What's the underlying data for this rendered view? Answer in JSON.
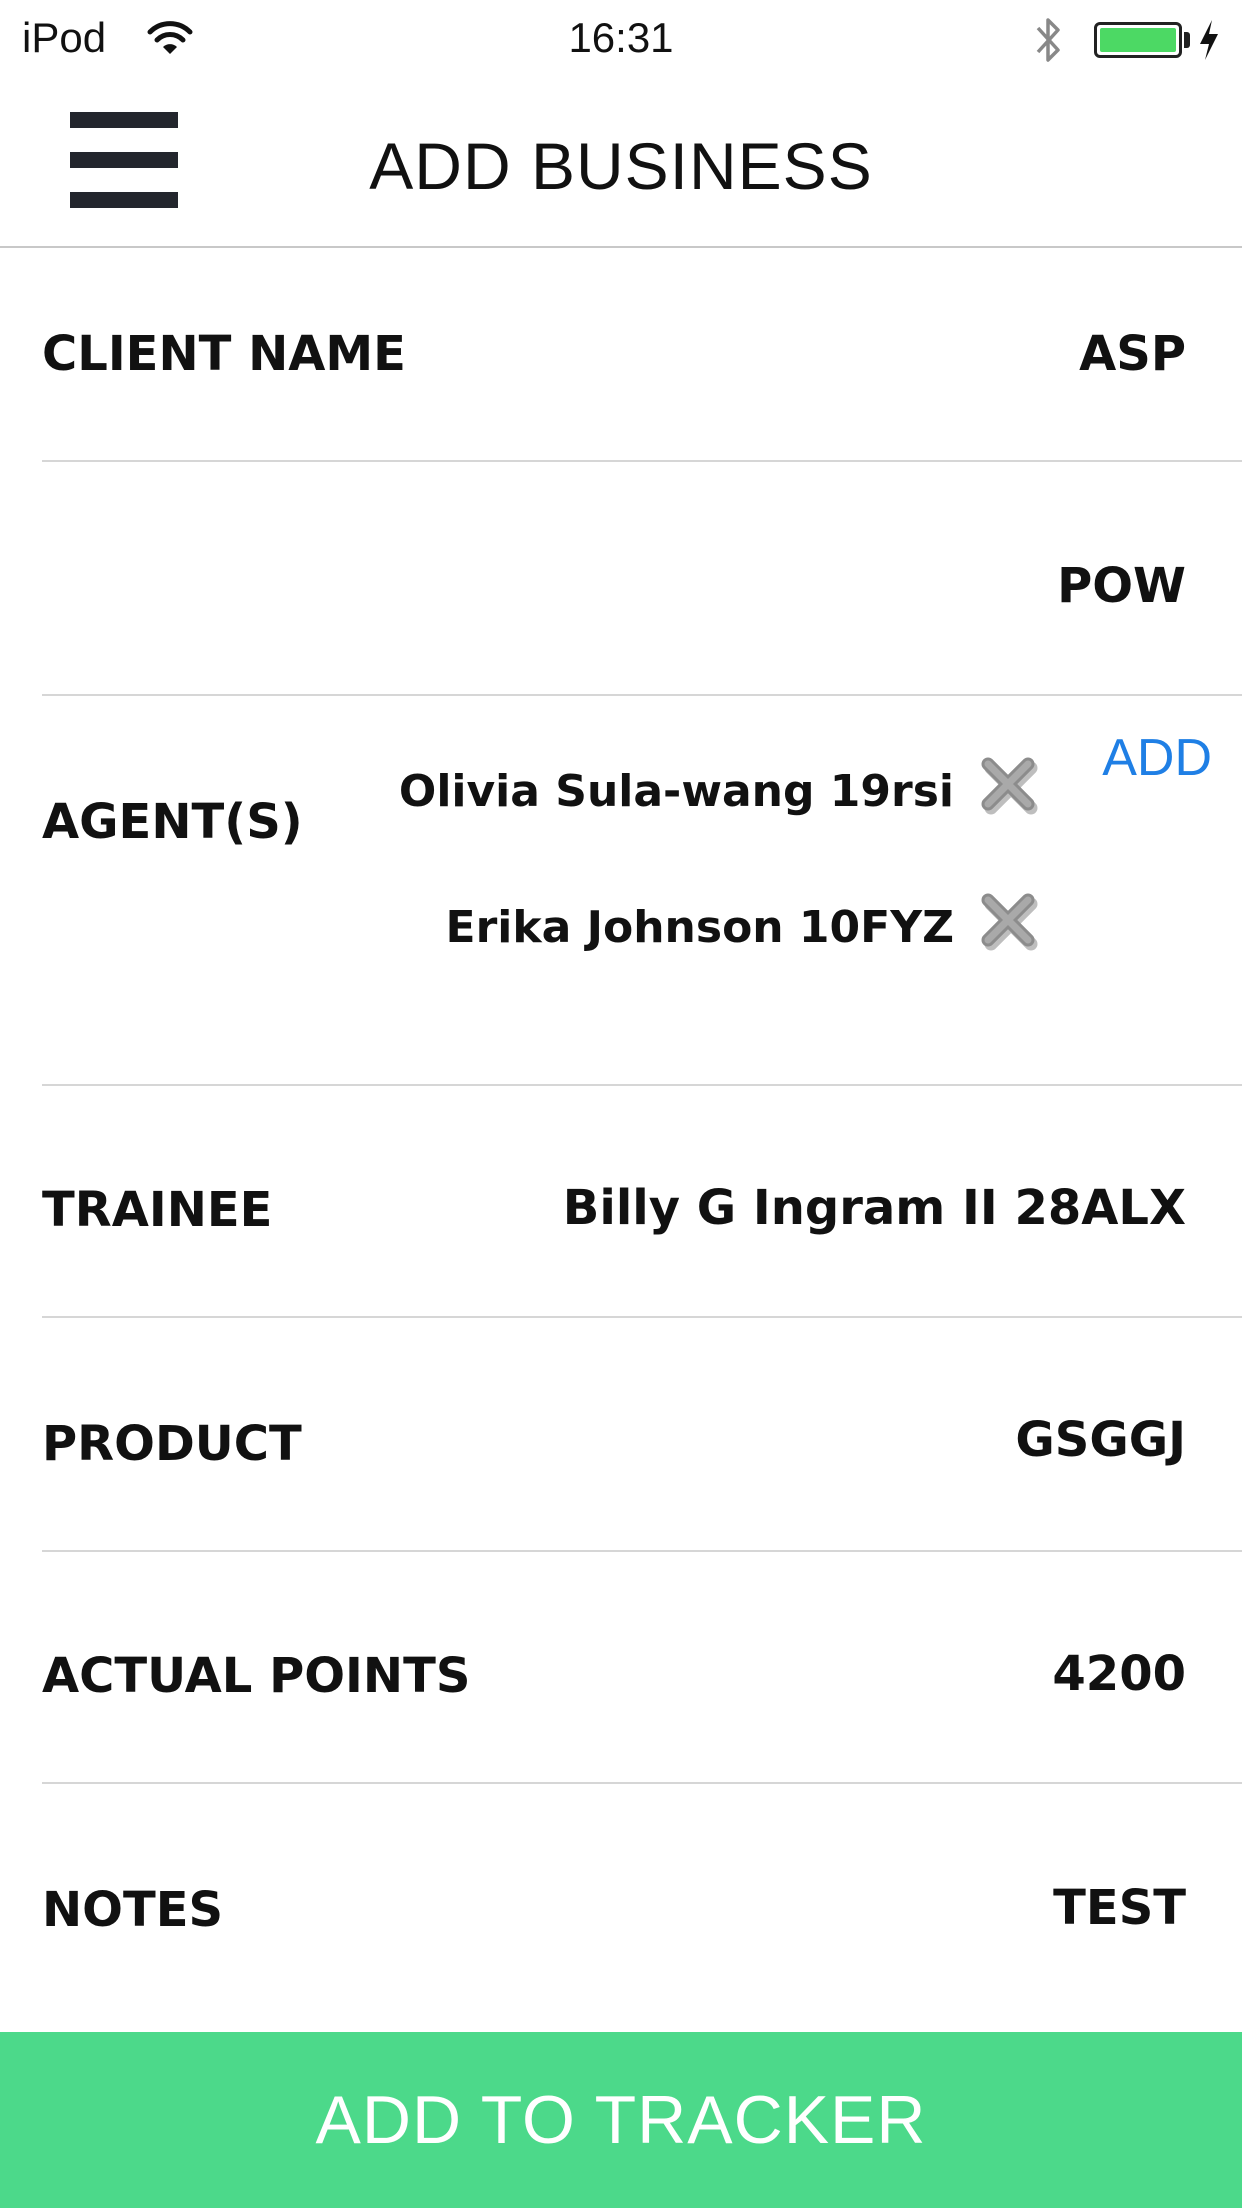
{
  "status_bar": {
    "carrier": "iPod",
    "time": "16:31",
    "battery_level": 1.0,
    "battery_color": "#4cd964"
  },
  "header": {
    "title": "ADD BUSINESS",
    "menu_icon": "hamburger-menu-icon"
  },
  "form": {
    "client_name": {
      "label": "CLIENT NAME",
      "value": "ASP"
    },
    "client_name_2": {
      "value": "POW"
    },
    "agents": {
      "label": "AGENT(S)",
      "add_label": "ADD",
      "items": [
        {
          "name": "Olivia Sula-wang 19rsi"
        },
        {
          "name": "Erika Johnson 10FYZ"
        }
      ],
      "remove_icon": "close-x-icon"
    },
    "trainee": {
      "label": "TRAINEE",
      "value": "Billy G Ingram II 28ALX"
    },
    "product": {
      "label": "PRODUCT",
      "value": "GSGGJ"
    },
    "actual_points": {
      "label": "ACTUAL POINTS",
      "value": "4200"
    },
    "notes": {
      "label": "NOTES",
      "value": "TEST"
    }
  },
  "actions": {
    "submit_label": "ADD TO TRACKER"
  },
  "colors": {
    "accent_green": "#4cd98a",
    "link_blue": "#1f7fe5"
  }
}
